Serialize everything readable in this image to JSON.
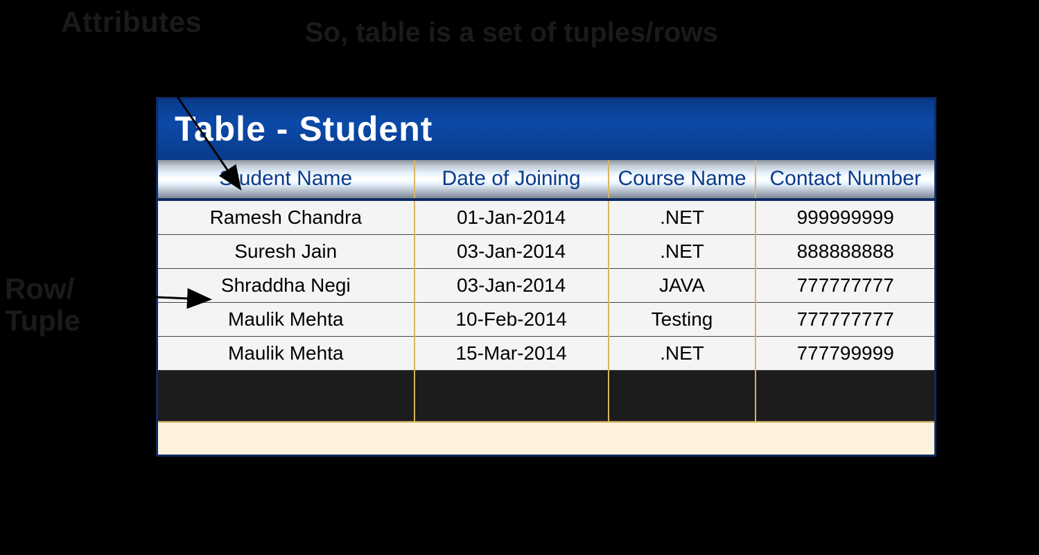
{
  "labels": {
    "attributes": "Attributes",
    "row_tuple_line1": "Row/",
    "row_tuple_line2": "Tuple"
  },
  "caption": "So, table is a set of tuples/rows",
  "table": {
    "title": "Table - Student",
    "headers": [
      "Student Name",
      "Date of Joining",
      "Course Name",
      "Contact Number"
    ],
    "rows": [
      {
        "cells": [
          "Ramesh Chandra",
          "01-Jan-2014",
          ".NET",
          "999999999"
        ]
      },
      {
        "cells": [
          "Suresh Jain",
          "03-Jan-2014",
          ".NET",
          "888888888"
        ]
      },
      {
        "cells": [
          "Shraddha Negi",
          "03-Jan-2014",
          "JAVA",
          "777777777"
        ]
      },
      {
        "cells": [
          "Maulik Mehta",
          "10-Feb-2014",
          "Testing",
          "777777777"
        ]
      },
      {
        "cells": [
          "Maulik Mehta",
          "15-Mar-2014",
          ".NET",
          "777799999"
        ]
      }
    ]
  }
}
